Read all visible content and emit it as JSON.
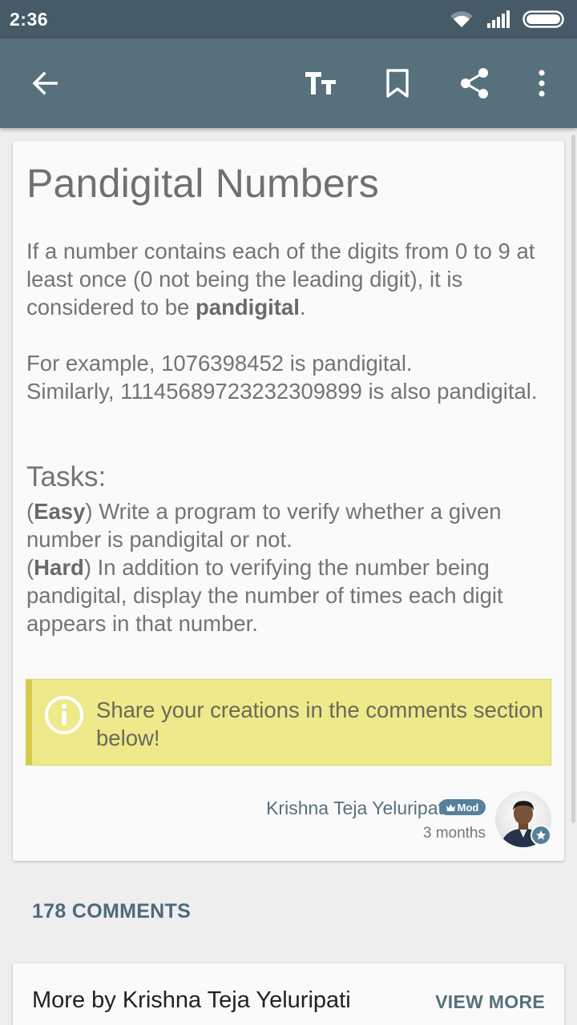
{
  "status_bar": {
    "time": "2:36",
    "icons": [
      "wifi-icon",
      "signal-icon",
      "battery-icon"
    ]
  },
  "app_bar": {
    "actions": [
      "back-arrow-icon",
      "text-size-icon",
      "bookmark-icon",
      "share-icon",
      "more-vert-icon"
    ]
  },
  "article": {
    "title": "Pandigital Numbers",
    "intro_before": "If a number contains each of the digits from 0 to 9 at least once (0 not being the leading digit), it is considered to be ",
    "intro_bold": "pandigital",
    "intro_after": ".",
    "example_line1": "For example, 1076398452 is pandigital.",
    "example_line2": "Similarly, 11145689723232309899 is also pandigital.",
    "tasks_heading": "Tasks:",
    "easy_label": "Easy",
    "easy_text": "Write a program to verify whether a given number is pandigital or not.",
    "hard_label": "Hard",
    "hard_text": "In addition to verifying the number being pandigital, display the number of times each digit appears in that number.",
    "notice": "Share your creations in the comments section below!",
    "author": "Krishna Teja Yeluripati",
    "author_badge": "Mod",
    "posted": "3 months"
  },
  "comments": {
    "count_label": "178 COMMENTS"
  },
  "more_by": {
    "title": "More by Krishna Teja Yeluripati",
    "view_more": "VIEW MORE"
  },
  "colors": {
    "status_bar": "#465b67",
    "app_bar": "#56707c",
    "notice_bg": "#eee98a",
    "notice_border": "#d3cc4e",
    "accent": "#56707c"
  }
}
